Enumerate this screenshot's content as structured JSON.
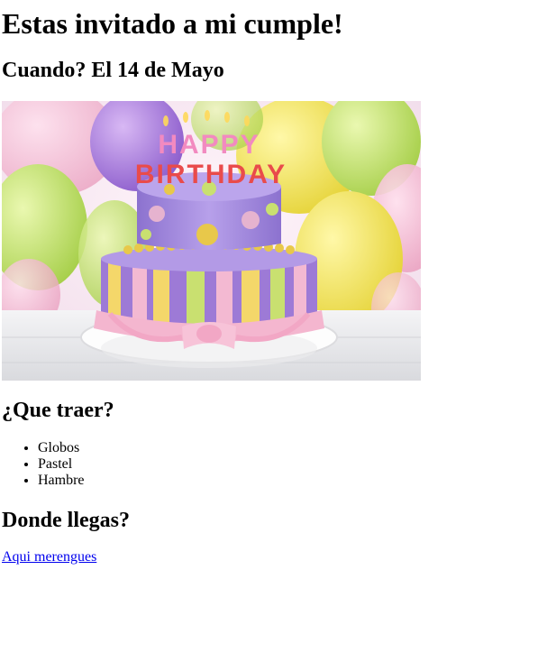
{
  "heading": "Estas invitado a mi cumple!",
  "when": "Cuando? El 14 de Mayo",
  "image": {
    "candle_text_top": "HAPPY",
    "candle_text_bottom": "BIRTHDAY",
    "colors": {
      "background_sky": "#f4e6f0",
      "balloon_purple": "#a67bd8",
      "balloon_yellow": "#f2e44a",
      "balloon_green": "#bfe26a",
      "balloon_pink": "#f3b9d2",
      "cake_top": "#a98ee0",
      "cake_bottom_stripe_yellow": "#f4d76a",
      "cake_bottom_stripe_purple": "#9d7ad6",
      "cake_bottom_stripe_green": "#c9e070",
      "ribbon_pink": "#f4b6cf",
      "dots_yellow": "#e8c84a",
      "table": "#e9eaee"
    }
  },
  "bring": {
    "heading": "¿Que traer?",
    "items": [
      "Globos",
      "Pastel",
      "Hambre"
    ]
  },
  "where": {
    "heading": "Donde llegas?",
    "link_text": "Aqui merengues"
  }
}
